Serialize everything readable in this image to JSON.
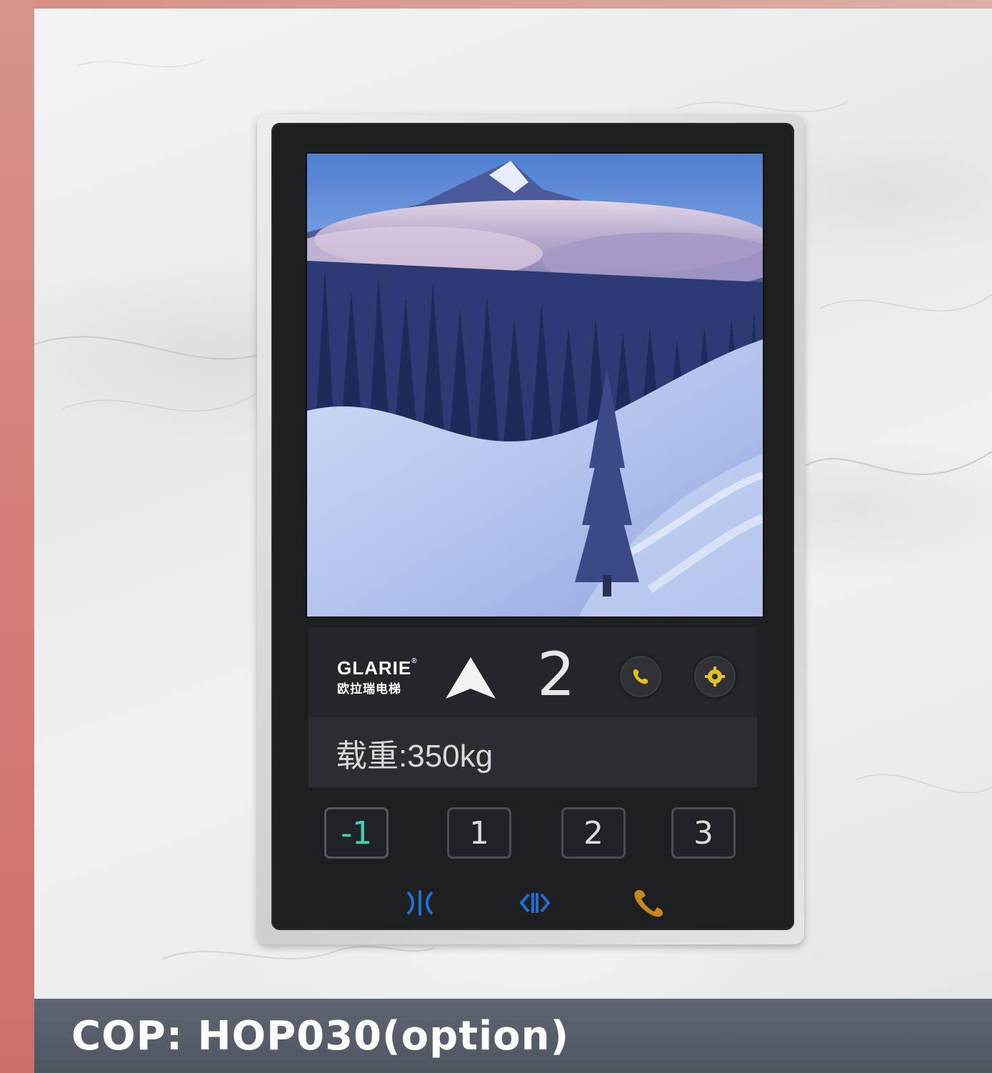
{
  "panel": {
    "brand_name": "GLARIE",
    "brand_registered": "®",
    "brand_chinese": "欧拉瑞电梯",
    "current_floor": "2",
    "direction": "up",
    "load_label": "载重:350kg",
    "floor_buttons": [
      {
        "label": "-1",
        "active": true
      },
      {
        "label": "1",
        "active": false
      },
      {
        "label": "2",
        "active": false
      },
      {
        "label": "3",
        "active": false
      }
    ],
    "bottom_icons": [
      "fan-icon",
      "door-open-icon",
      "alarm-bell-icon"
    ],
    "top_icons": [
      "phone-icon",
      "gear-icon"
    ],
    "colors": {
      "accent_teal": "#3fd0b8",
      "icon_yellow": "#e2c21a",
      "icon_blue": "#1f6fd6",
      "icon_orange": "#c8861c"
    }
  },
  "caption": {
    "text": "COP: HOP030(option)"
  }
}
